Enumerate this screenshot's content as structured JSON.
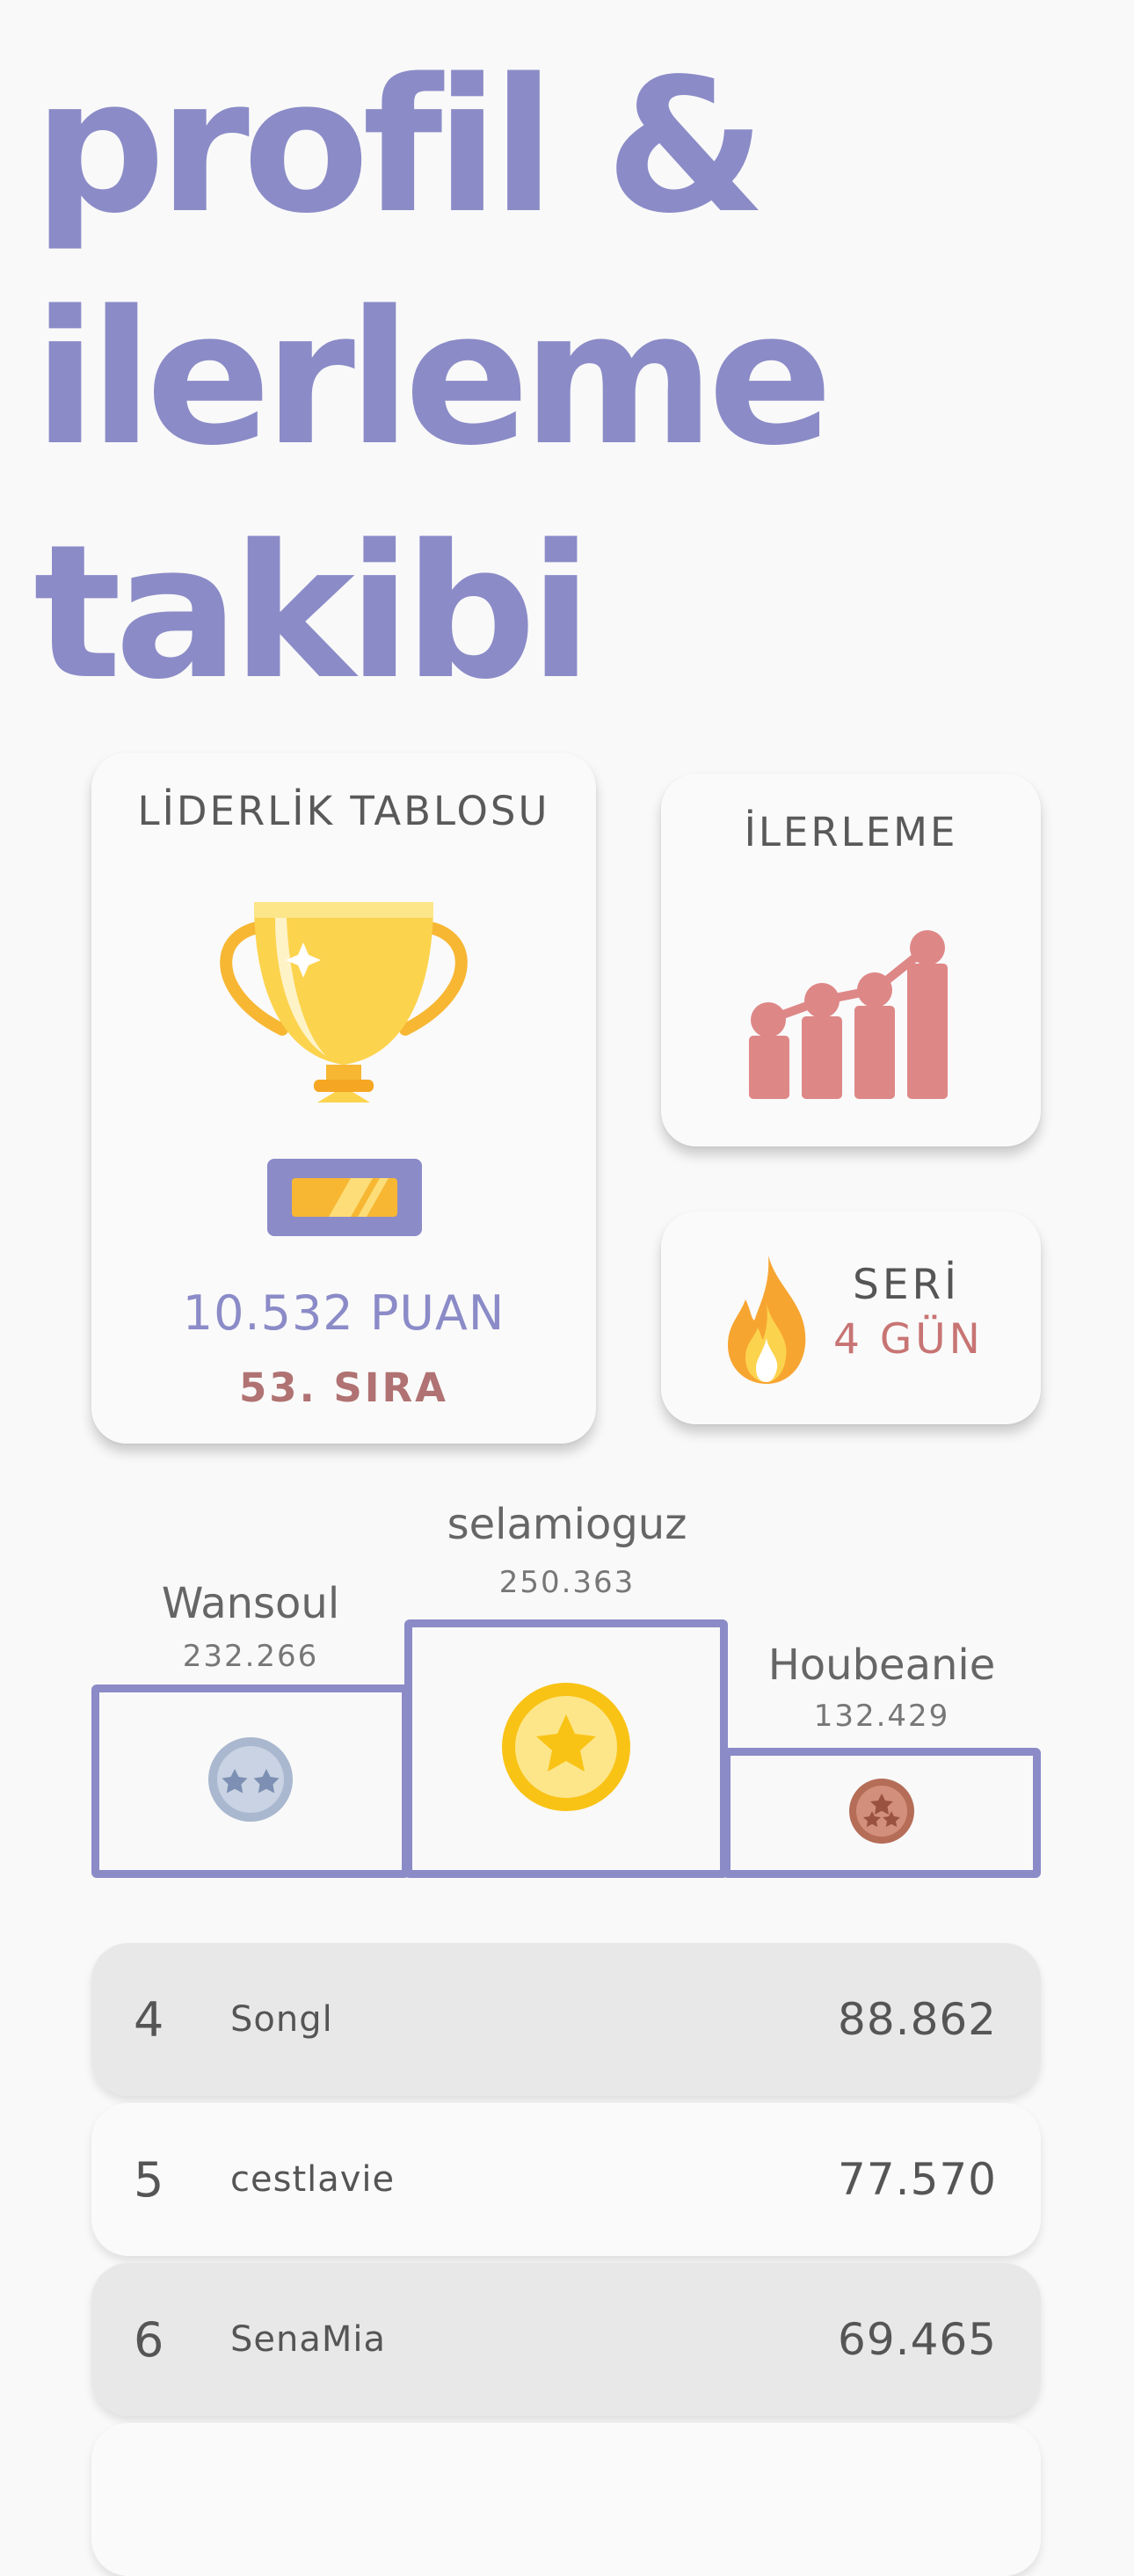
{
  "headline": {
    "line1": "profil &",
    "line2": "ilerleme",
    "line3": "takibi"
  },
  "leaderboard_card": {
    "title": "LİDERLİK TABLOSU",
    "icon": "trophy-icon",
    "points": "10.532 PUAN",
    "rank": "53. SIRA"
  },
  "progress_card": {
    "title": "İLERLEME",
    "icon": "growth-chart-icon"
  },
  "streak_card": {
    "icon": "flame-icon",
    "label": "SERİ",
    "value": "4 GÜN"
  },
  "podium": {
    "first": {
      "name": "selamioguz",
      "score": "250.363",
      "medal": "gold-medal-icon"
    },
    "second": {
      "name": "Wansoul",
      "score": "232.266",
      "medal": "silver-medal-icon"
    },
    "third": {
      "name": "Houbeanie",
      "score": "132.429",
      "medal": "bronze-medal-icon"
    }
  },
  "rankings": [
    {
      "position": "4",
      "name": "Songl",
      "score": "88.862"
    },
    {
      "position": "5",
      "name": "cestlavie",
      "score": "77.570"
    },
    {
      "position": "6",
      "name": "SenaMia",
      "score": "69.465"
    }
  ],
  "colors": {
    "accent": "#8b8bc8",
    "rank_text": "#b07272",
    "streak_value": "#c87474",
    "chart": "#de8787",
    "gold": "#f9c316",
    "silver": "#a9b7cf",
    "bronze": "#b56d58",
    "background": "#f9f9f9"
  }
}
